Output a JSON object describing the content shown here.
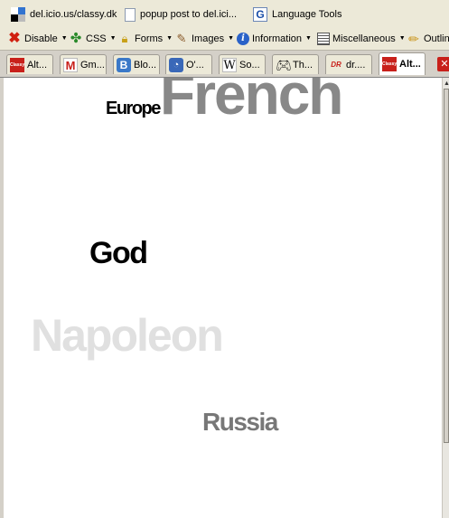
{
  "bookmarks": [
    {
      "label": "del.icio.us/classy.dk",
      "icon": "delicious-icon"
    },
    {
      "label": "popup post to del.ici...",
      "icon": "doc-icon"
    },
    {
      "label": "Language Tools",
      "icon": "google-icon"
    }
  ],
  "devbar": [
    {
      "label": "Disable",
      "icon": "x-icon"
    },
    {
      "label": "CSS",
      "icon": "puzzle-icon"
    },
    {
      "label": "Forms",
      "icon": "lock-icon"
    },
    {
      "label": "Images",
      "icon": "images-icon"
    },
    {
      "label": "Information",
      "icon": "info-icon"
    },
    {
      "label": "Miscellaneous",
      "icon": "misc-icon"
    },
    {
      "label": "Outlin",
      "icon": "pencil-icon"
    }
  ],
  "tabs": [
    {
      "label": "Alt...",
      "icon": "classy-icon",
      "active": false
    },
    {
      "label": "Gm...",
      "icon": "gmail-icon",
      "active": false
    },
    {
      "label": "Blo...",
      "icon": "blogger-icon",
      "active": false
    },
    {
      "label": "O'...",
      "icon": "rss-icon",
      "active": false
    },
    {
      "label": "So...",
      "icon": "wiki-icon",
      "active": false
    },
    {
      "label": "Th...",
      "icon": "game-icon",
      "active": false
    },
    {
      "label": "dr....",
      "icon": "dr-icon",
      "active": false
    },
    {
      "label": "Alt...",
      "icon": "classy-icon",
      "active": true
    }
  ],
  "tag_cloud": [
    {
      "text": "Europe",
      "color": "#000000"
    },
    {
      "text": "French",
      "color": "#888888"
    },
    {
      "text": "God",
      "color": "#000000"
    },
    {
      "text": "Napoleon",
      "color": "#e0e0e0"
    },
    {
      "text": "Russia",
      "color": "#777777"
    }
  ]
}
